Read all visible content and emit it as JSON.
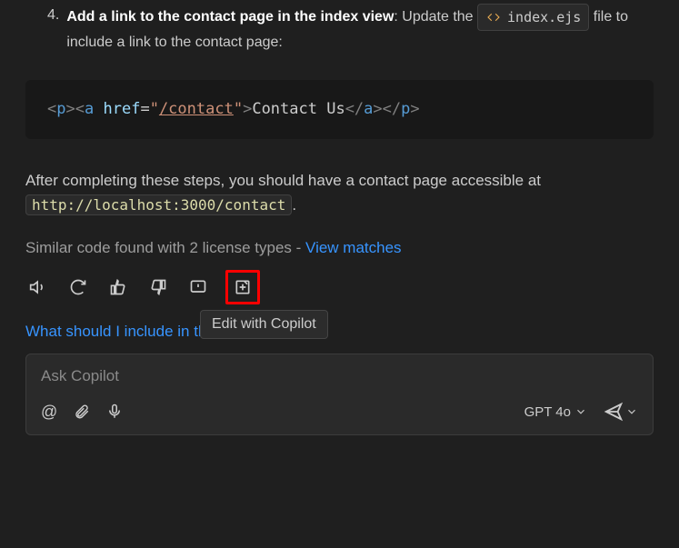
{
  "step": {
    "number": "4.",
    "bold": "Add a link to the contact page in the index view",
    "tail": ": Update the",
    "file_name": "index.ejs",
    "after_file": "file to include a link to the contact page:"
  },
  "code": {
    "open_p": "p",
    "open_a": "a",
    "attr": "href",
    "eq": "=",
    "q1": "\"",
    "href": "/contact",
    "q2": "\"",
    "link_text": "Contact Us",
    "close_a": "a",
    "close_p": "p"
  },
  "para": {
    "text_before": "After completing these steps, you should have a contact page accessible at ",
    "url": "http://localhost:3000/contact",
    "text_after": "."
  },
  "meta": {
    "text": "Similar code found with 2 license types - ",
    "link": "View matches"
  },
  "tooltip": "Edit with Copilot",
  "suggestion": "What should I include in the form?",
  "input": {
    "placeholder": "Ask Copilot",
    "at": "@",
    "model": "GPT 4o"
  }
}
